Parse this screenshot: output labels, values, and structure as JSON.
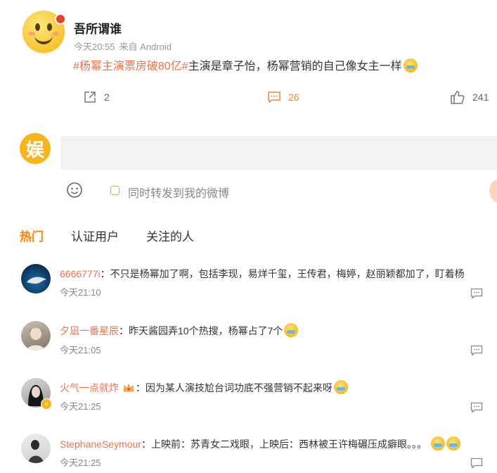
{
  "post": {
    "author": "吾所谓谁",
    "time": "今天20:55",
    "source": "来自 Android",
    "topic": "#杨幂主演票房破80亿#",
    "text": "主演是章子怡，杨幂营销的自己像女主一样",
    "reposts": "2",
    "comments": "26",
    "likes": "241"
  },
  "reply_box": {
    "avatar_char": "娱",
    "placeholder": "",
    "forward_label": "同时转发到我的微博"
  },
  "tabs": [
    "热门",
    "认证用户",
    "关注的人"
  ],
  "comments": [
    {
      "user": "6666777i",
      "sep": "：",
      "text": "不只是杨幂加了啊，包括李现，易烊千玺，王传君，梅婷，赵丽颖都加了，盯着杨",
      "time": "今天21:10"
    },
    {
      "user": "夕凪一番星辰",
      "sep": "：",
      "text": "昨天酱园弄10个热搜，杨幂占了7个",
      "time": "今天21:05"
    },
    {
      "user": "火气一点就炸",
      "sep": "：",
      "text": "因为某人演技尬台词功底不强营销不起来呀",
      "time": "今天21:25"
    },
    {
      "user": "StephaneSeymour",
      "sep": "：",
      "text": "上映前：苏青女二戏眼，上映后：西林被王许梅碾压成癖眼。。。",
      "time": "今天21:25"
    }
  ],
  "colors": {
    "accent": "#ff8200",
    "link": "#eb7350"
  },
  "icons": [
    "repost-icon",
    "comment-icon",
    "like-icon",
    "smile-icon",
    "reply-icon"
  ]
}
